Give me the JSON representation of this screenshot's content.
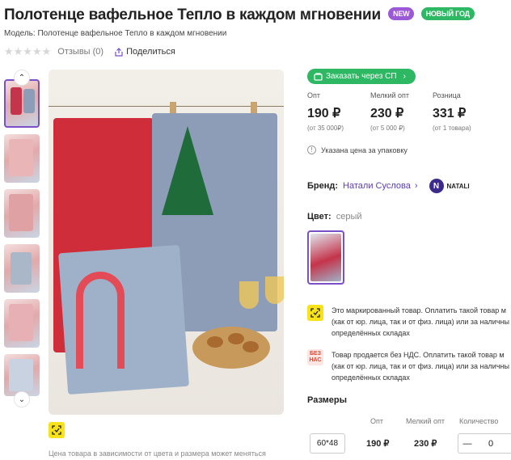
{
  "product": {
    "title": "Полотенце вафельное Тепло в каждом мгновении",
    "badge_new": "NEW",
    "badge_year": "НОВЫЙ ГОД",
    "model": "Модель: Полотенце вафельное Тепло в каждом мгновении",
    "reviews": "Отзывы (0)",
    "share": "Поделиться"
  },
  "gallery": {
    "note": "Цена товара в зависимости от цвета и размера может меняться"
  },
  "order_sp": "Заказать через СП",
  "prices": [
    {
      "label": "Опт",
      "value": "190 ₽",
      "sub": "(от 35 000₽)"
    },
    {
      "label": "Мелкий опт",
      "value": "230 ₽",
      "sub": "(от 5 000 ₽)"
    },
    {
      "label": "Розница",
      "value": "331 ₽",
      "sub": "(от 1 товара)"
    }
  ],
  "price_note": "Указана цена за упаковку",
  "brand": {
    "label": "Бренд:",
    "value": "Натали Суслова",
    "logo_text": "NATALI"
  },
  "color": {
    "label": "Цвет:",
    "value": "серый"
  },
  "notices": [
    {
      "text": "Это маркированный товар. Оплатить такой товар м (как от юр. лица, так и от физ. лица) или за наличны определённых складах"
    },
    {
      "icon_text": "БЕЗ НАС",
      "text": "Товар продается без НДС. Оплатить такой товар м (как от юр. лица, так и от физ. лица) или за наличны определённых складах"
    }
  ],
  "sizes": {
    "title": "Размеры",
    "headers": {
      "opt": "Опт",
      "small_opt": "Мелкий опт",
      "qty": "Количество"
    },
    "rows": [
      {
        "size": "60*48",
        "opt": "190 ₽",
        "small_opt": "230 ₽",
        "qty": "0"
      }
    ]
  },
  "icons": {
    "star": "star-icon",
    "share": "share-icon",
    "chevron_up": "chevron-up-icon",
    "chevron_down": "chevron-down-icon",
    "info": "info-icon",
    "marking": "marking-icon",
    "cart": "cart-icon"
  },
  "colors": {
    "accent": "#7a4fc7",
    "green": "#2fb863",
    "yellow": "#f7e21b"
  }
}
